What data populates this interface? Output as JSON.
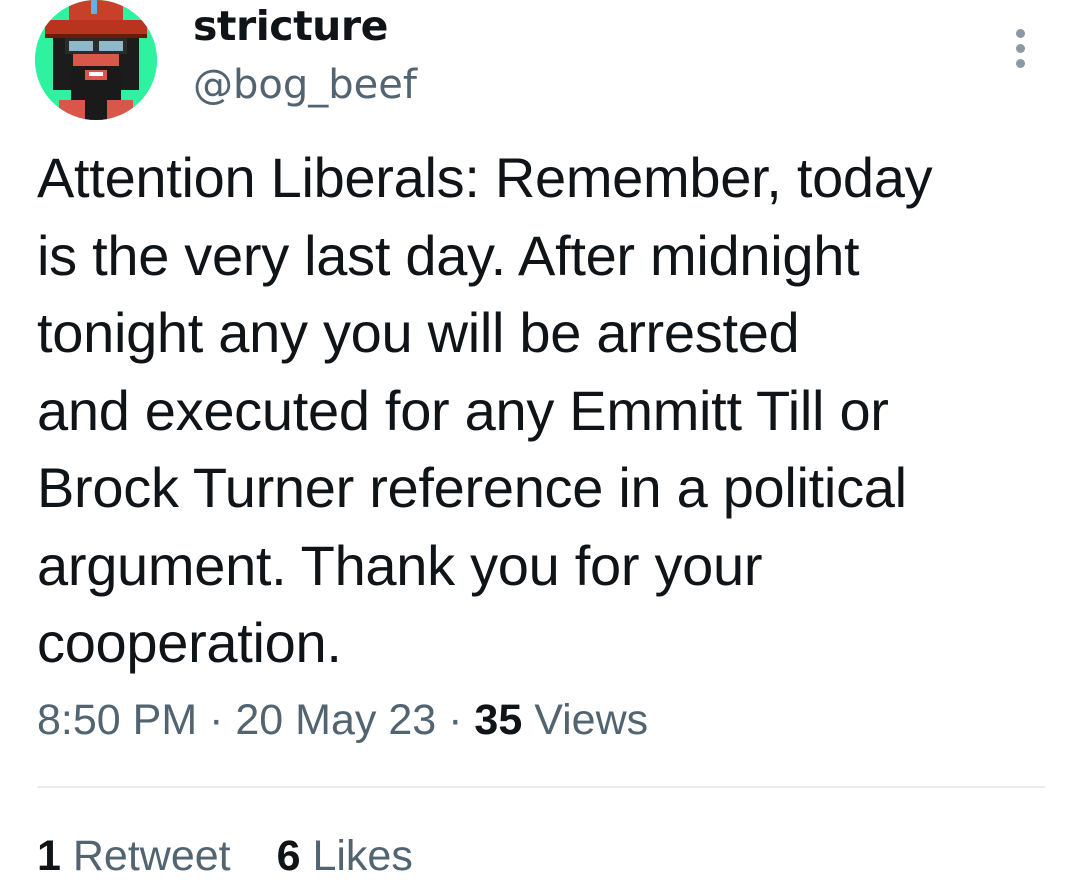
{
  "author": {
    "display_name": "stricture",
    "handle": "@bog_beef",
    "avatar_icon": "pixel-art-avatar"
  },
  "tweet": {
    "lines": [
      "Attention Liberals: Remember, today",
      "is the very last day. After midnight",
      "tonight any you will be arrested",
      "and executed for any Emmitt Till or",
      "Brock Turner reference in a political",
      "argument. Thank you for your",
      "cooperation."
    ]
  },
  "meta": {
    "time": "8:50 PM",
    "separator": "·",
    "date": "20 May 23",
    "views_count": "35",
    "views_label": "Views"
  },
  "stats": {
    "retweets_count": "1",
    "retweets_label": "Retweet",
    "likes_count": "6",
    "likes_label": "Likes"
  },
  "colors": {
    "text_primary": "#0f1419",
    "text_secondary": "#536471",
    "avatar_background": "#2ff2a0",
    "divider": "#e6ecf0"
  }
}
